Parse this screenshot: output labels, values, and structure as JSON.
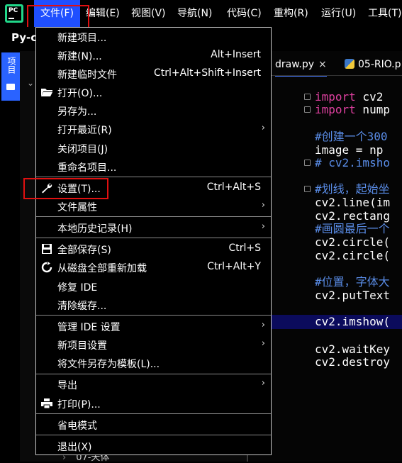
{
  "menubar": {
    "logo_text": "PC",
    "items": [
      "文件(F)",
      "编辑(E)",
      "视图(V)",
      "导航(N)",
      "代码(C)",
      "重构(R)",
      "运行(U)",
      "工具(T)"
    ]
  },
  "project": {
    "title": "Py-c",
    "tool_tab_label": "项目",
    "tree_last_item": "07-天体"
  },
  "editor": {
    "tabs": [
      {
        "label": "draw.py",
        "close": "×"
      },
      {
        "label": "05-RIO.p"
      }
    ],
    "code": [
      {
        "kw": "import",
        "rest": " cv2"
      },
      {
        "kw": "import",
        "rest": " nump"
      },
      {
        "comment": "#创建一个300"
      },
      {
        "text": "image = np"
      },
      {
        "comment": "# cv2.imsho"
      },
      {
        "comment": "#划线，起始坐"
      },
      {
        "text": "cv2.line(im"
      },
      {
        "text": "cv2.rectang"
      },
      {
        "comment": "#画圆最后一个"
      },
      {
        "text": "cv2.circle("
      },
      {
        "text": "cv2.circle("
      },
      {
        "comment": "#位置，字体大"
      },
      {
        "text": "cv2.putText"
      },
      {
        "text": "cv2.imshow("
      },
      {
        "text": "cv2.waitKey"
      },
      {
        "text": "cv2.destroy"
      }
    ]
  },
  "file_menu": {
    "items": [
      {
        "label": "新建项目..."
      },
      {
        "label": "新建(N)...",
        "shortcut": "Alt+Insert"
      },
      {
        "label": "新建临时文件",
        "shortcut": "Ctrl+Alt+Shift+Insert"
      },
      {
        "label": "打开(O)...",
        "icon": "folder-icon"
      },
      {
        "label": "另存为..."
      },
      {
        "label": "打开最近(R)",
        "submenu": "›"
      },
      {
        "label": "关闭项目(J)"
      },
      {
        "label": "重命名项目..."
      },
      {
        "label": "设置(T)...",
        "shortcut": "Ctrl+Alt+S",
        "icon": "wrench-icon"
      },
      {
        "label": "文件属性",
        "submenu": "›"
      },
      {
        "label": "本地历史记录(H)",
        "submenu": "›"
      },
      {
        "label": "全部保存(S)",
        "shortcut": "Ctrl+S",
        "icon": "save-icon"
      },
      {
        "label": "从磁盘全部重新加载",
        "shortcut": "Ctrl+Alt+Y",
        "icon": "reload-icon"
      },
      {
        "label": "修复 IDE"
      },
      {
        "label": "清除缓存..."
      },
      {
        "label": "管理 IDE 设置",
        "submenu": "›"
      },
      {
        "label": "新项目设置",
        "submenu": "›"
      },
      {
        "label": "将文件另存为模板(L)..."
      },
      {
        "label": "导出",
        "submenu": "›"
      },
      {
        "label": "打印(P)...",
        "icon": "printer-icon"
      },
      {
        "label": "省电模式"
      },
      {
        "label": "退出(X)"
      }
    ]
  },
  "colors": {
    "accent": "#1f4fff",
    "highlight_box": "#e01010",
    "keyword": "#e040a0",
    "comment": "#5a8de8",
    "caret_line": "#0b0b5c"
  }
}
